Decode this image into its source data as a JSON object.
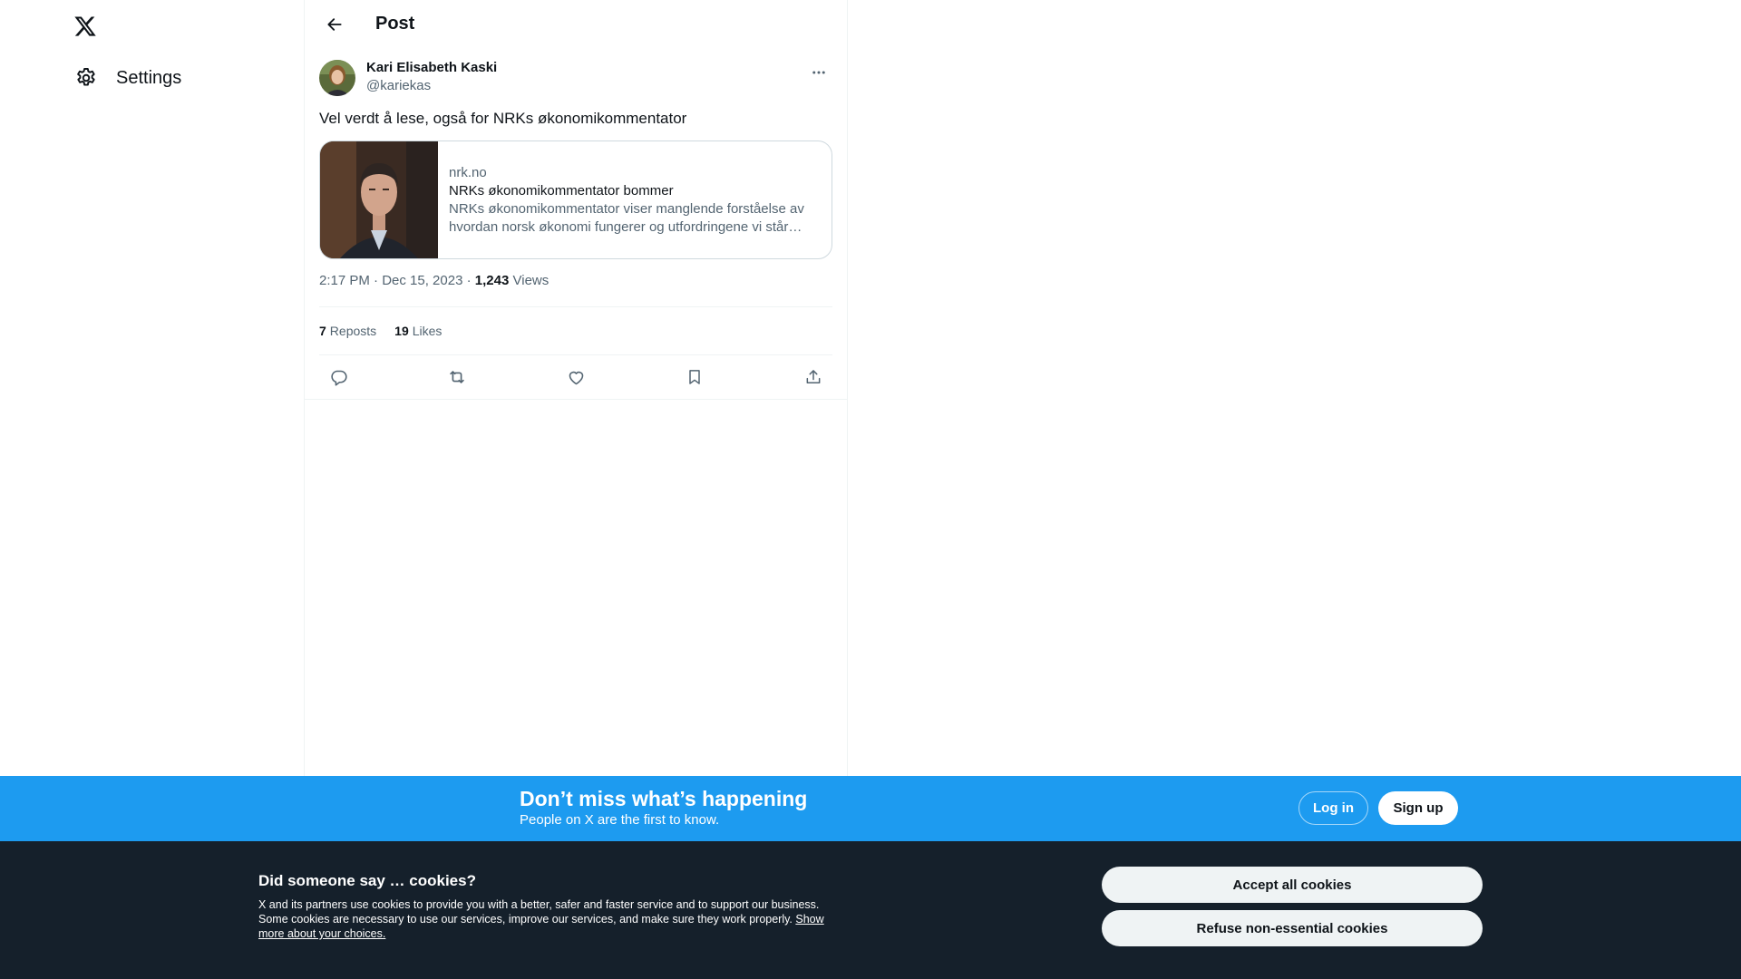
{
  "nav": {
    "logo": "x-logo",
    "settings_label": "Settings"
  },
  "header": {
    "title": "Post"
  },
  "post": {
    "author_name": "Kari Elisabeth Kaski",
    "author_handle": "@kariekas",
    "text": "Vel verdt å lese, også for NRKs økonomikommentator",
    "card": {
      "domain": "nrk.no",
      "title": "NRKs økonomikommentator bommer",
      "description": "NRKs økonomikommentator viser manglende forståelse av hvordan norsk økonomi fungerer og utfordringene vi står overfor."
    },
    "timestamp": "2:17 PM · Dec 15, 2023",
    "separator": " · ",
    "views_count": "1,243",
    "views_label": "Views",
    "reposts_count": "7",
    "reposts_label": "Reposts",
    "likes_count": "19",
    "likes_label": "Likes"
  },
  "banner": {
    "title": "Don’t miss what’s happening",
    "subtitle": "People on X are the first to know.",
    "login_label": "Log in",
    "signup_label": "Sign up",
    "color": "#1d9bf0"
  },
  "cookies": {
    "title": "Did someone say … cookies?",
    "text": "X and its partners use cookies to provide you with a better, safer and faster service and to support our business. Some cookies are necessary to use our services, improve our services, and make sure they work properly.",
    "link_label": "Show more about your choices.",
    "accept_label": "Accept all cookies",
    "refuse_label": "Refuse non-essential cookies",
    "background": "#15202b"
  }
}
